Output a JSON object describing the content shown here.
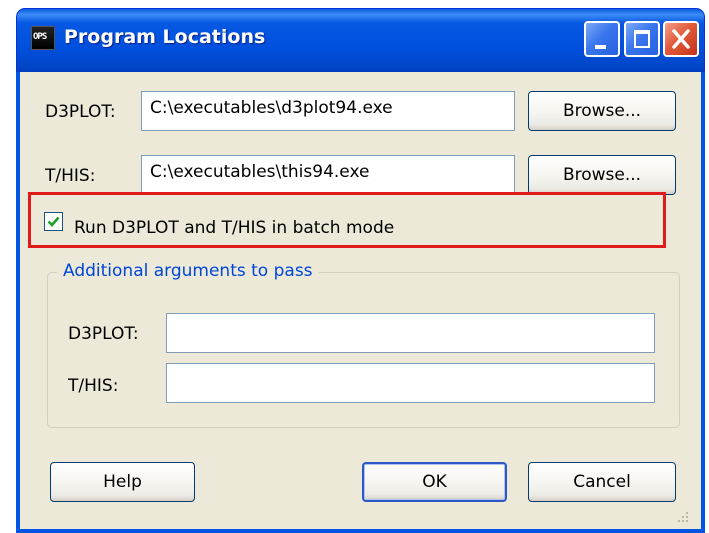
{
  "window": {
    "title": "Program Locations",
    "app_icon_label": "OPS"
  },
  "programs": {
    "d3plot_label": "D3PLOT:",
    "d3plot_path": "C:\\executables\\d3plot94.exe",
    "this_label": "T/HIS:",
    "this_path": "C:\\executables\\this94.exe",
    "browse_label": "Browse..."
  },
  "batch": {
    "label": "Run D3PLOT and T/HIS in batch mode",
    "checked": true
  },
  "arguments": {
    "group_title": "Additional arguments to pass",
    "d3plot_label": "D3PLOT:",
    "d3plot_value": "",
    "this_label": "T/HIS:",
    "this_value": ""
  },
  "buttons": {
    "help": "Help",
    "ok": "OK",
    "cancel": "Cancel"
  },
  "colors": {
    "titlebar": "#0054e3",
    "dialog_bg": "#ece9d8",
    "highlight": "#e01b1b",
    "group_title": "#0046d5"
  },
  "icons": [
    "app-icon",
    "minimize-icon",
    "maximize-icon",
    "close-icon",
    "checkmark-icon",
    "resize-grip-icon"
  ]
}
